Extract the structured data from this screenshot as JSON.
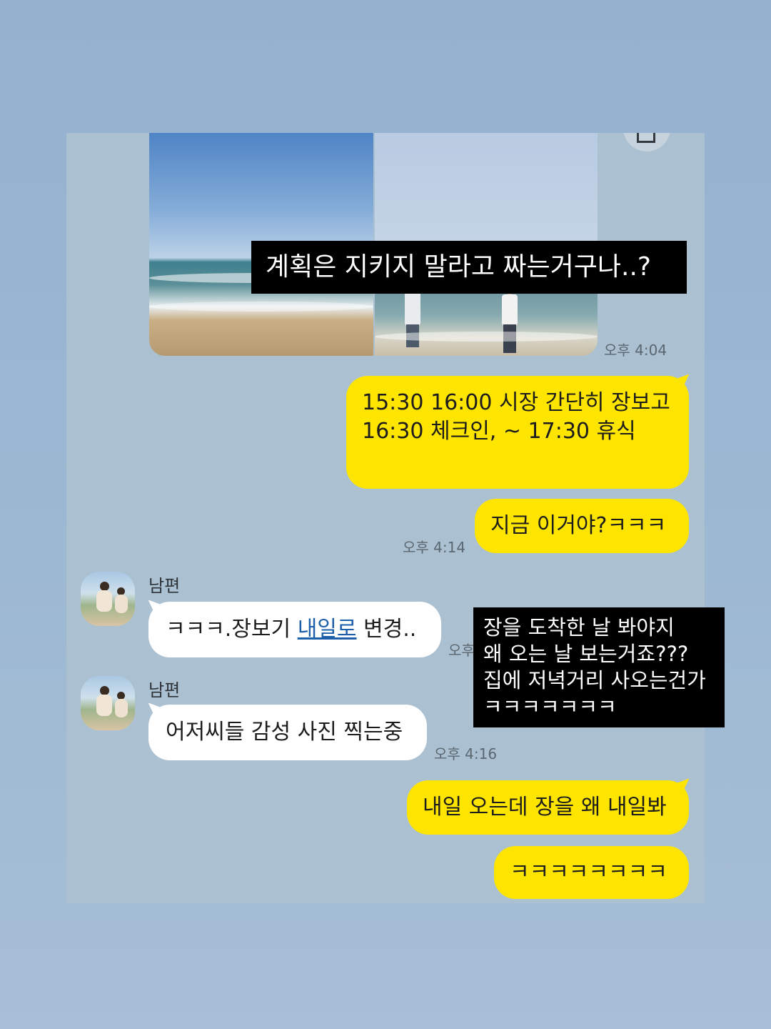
{
  "captions": {
    "top": "계획은 지키지 말라고 짜는거구나..?",
    "middle": "장을 도착한 날 봐야지\n왜 오는 날 보는거죠???\n집에 저녁거리 사오는건가\nㅋㅋㅋㅋㅋㅋㅋ"
  },
  "chat": {
    "photo_time": "오후 4:04",
    "messages": {
      "schedule": "15:30 16:00 시장 간단히 장보고\n16:30 체크인, ~ 17:30 휴식",
      "now_this": "지금 이거야?ㅋㅋㅋ",
      "now_this_time": "오후 4:14",
      "husband_name_1": "남편",
      "husband_msg_1_prefix": "ㅋㅋㅋ.장보기 ",
      "husband_msg_1_link": "내일로",
      "husband_msg_1_suffix": " 변경..",
      "husband_msg_1_time_partial": "오후",
      "husband_name_2": "남편",
      "husband_msg_2": "어저씨들 감성 사진 찍는중",
      "husband_msg_2_time": "오후 4:16",
      "reply_1": "내일 오는데 장을 왜 내일봐",
      "reply_2": "ㅋㅋㅋㅋㅋㅋㅋㅋ"
    }
  },
  "colors": {
    "background": "#94b1d0",
    "chat_background": "#abc1d1",
    "my_bubble": "#fee500",
    "their_bubble": "#ffffff",
    "caption_box": "#000000"
  }
}
